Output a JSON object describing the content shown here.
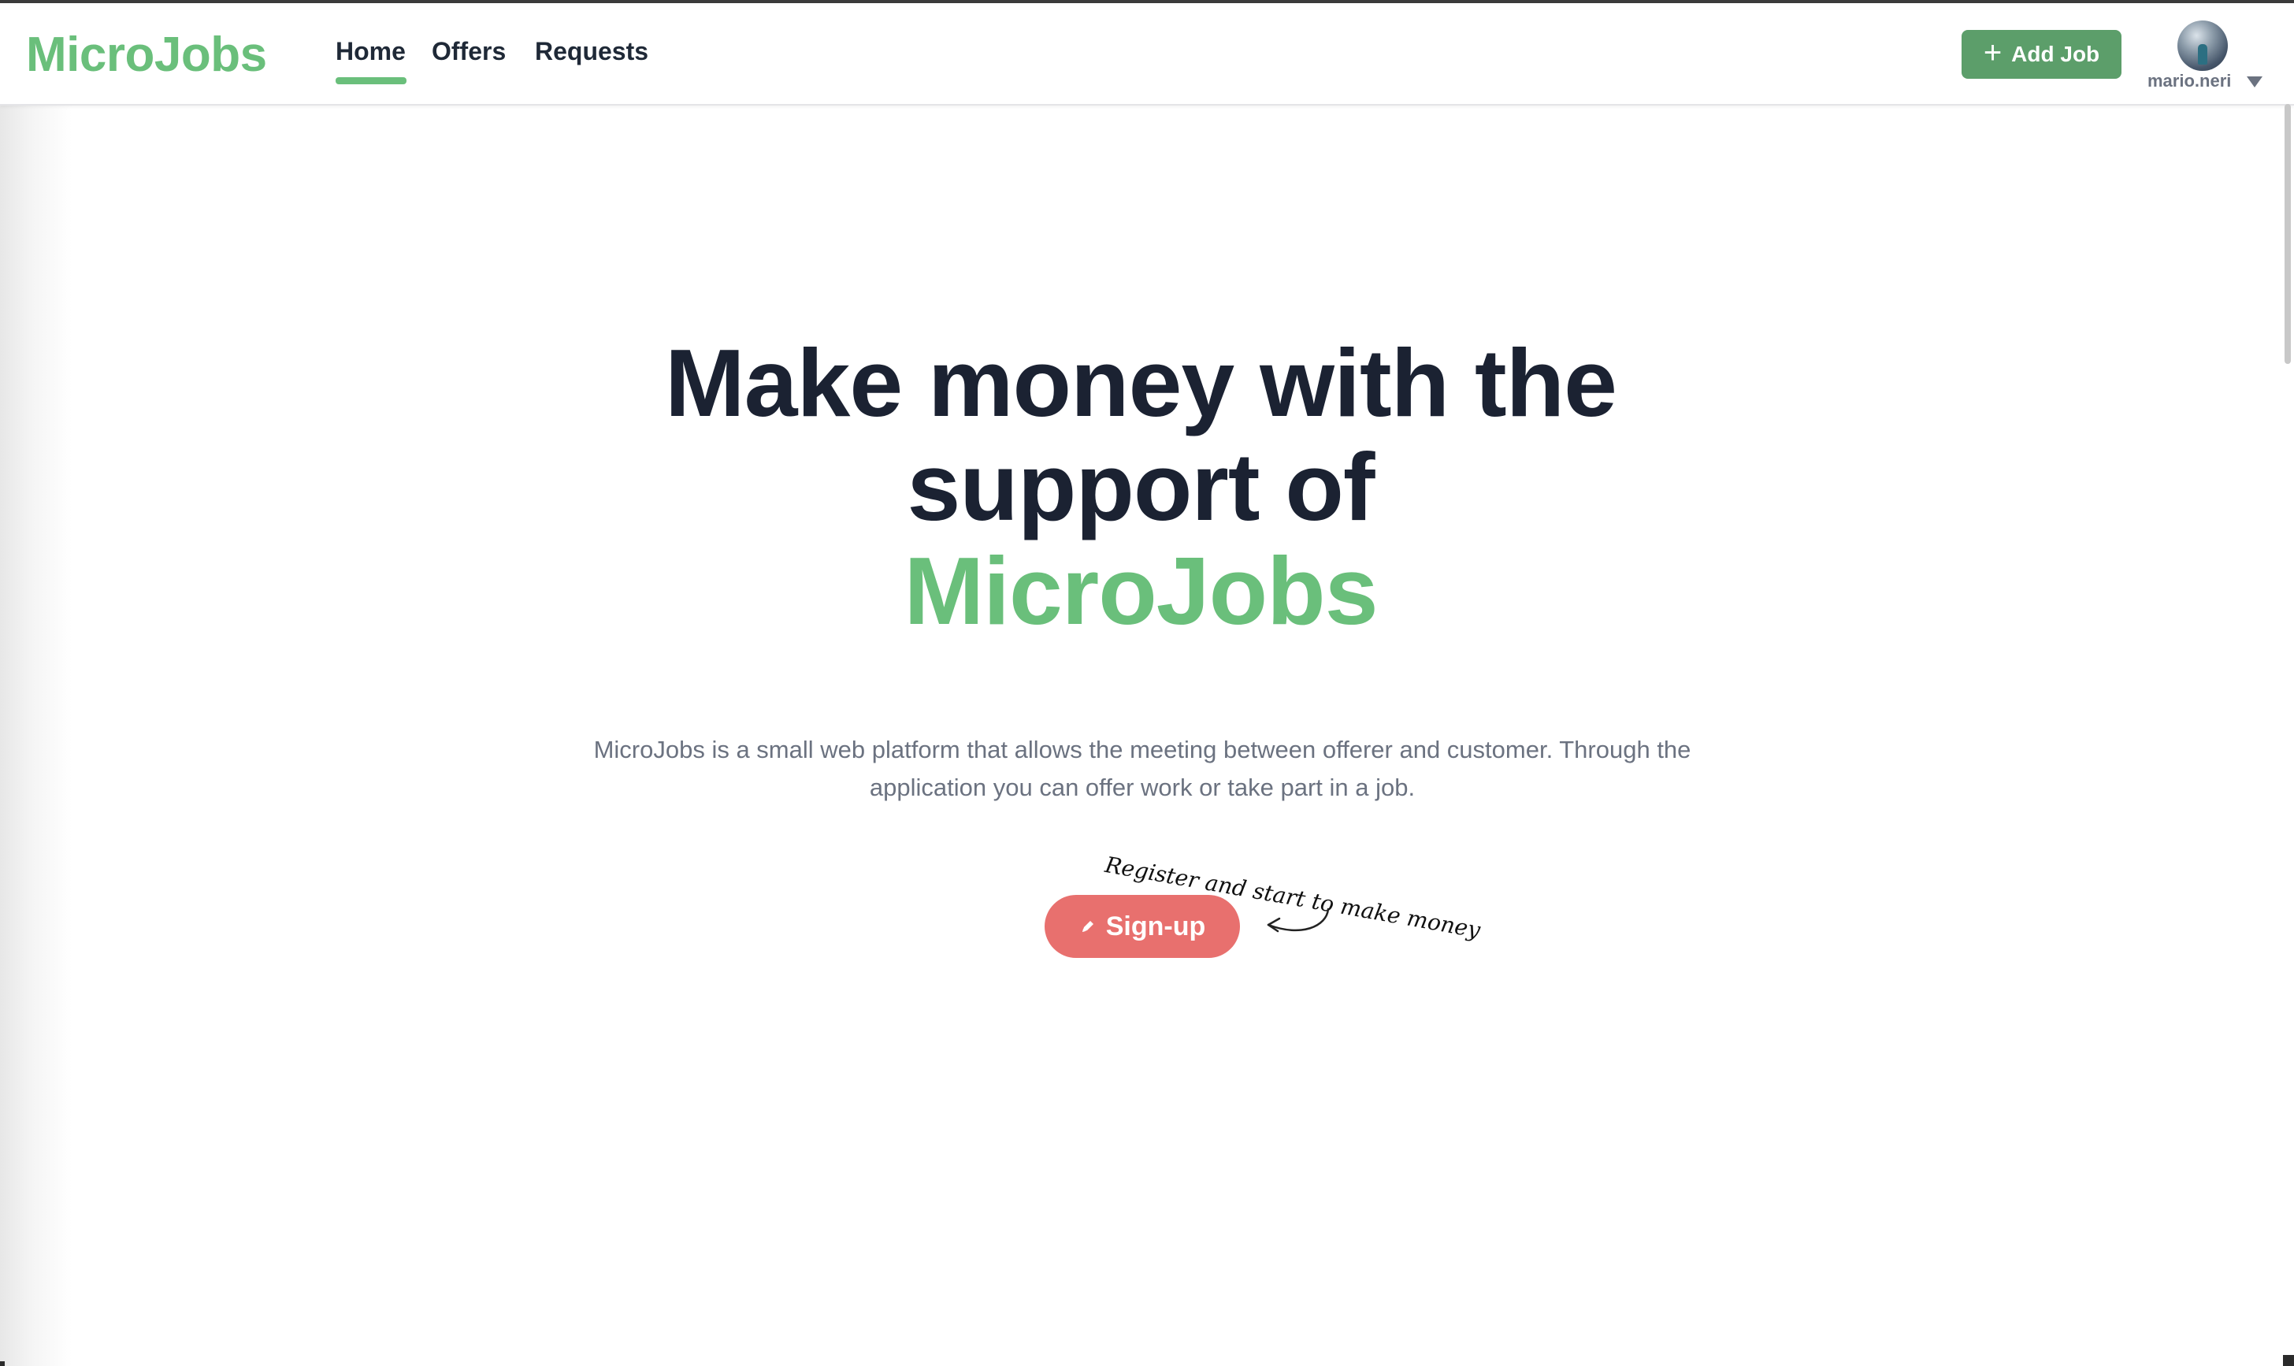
{
  "navbar": {
    "brand": "MicroJobs",
    "links": [
      {
        "label": "Home",
        "active": true
      },
      {
        "label": "Offers",
        "active": false
      },
      {
        "label": "Requests",
        "active": false
      }
    ],
    "add_job_label": "Add Job",
    "add_job_icon": "plus-icon",
    "user": {
      "username": "mario.neri",
      "avatar_icon": "avatar",
      "dropdown_icon": "caret-down-icon"
    }
  },
  "hero": {
    "title_line1": "Make money with the",
    "title_line2": "support of",
    "title_brand": "MicroJobs",
    "description": "MicroJobs is a small web platform that allows the meeting between offerer and customer. Through the application you can offer work or take part in a job.",
    "signup_label": "Sign-up",
    "signup_icon": "pen-icon",
    "annotation": "Register and start to make money"
  },
  "colors": {
    "brand_green": "#6abf7b",
    "button_green": "#5c9e6a",
    "signup_red": "#e8706e",
    "text_dark": "#1b2232",
    "text_muted": "#6b7280"
  }
}
